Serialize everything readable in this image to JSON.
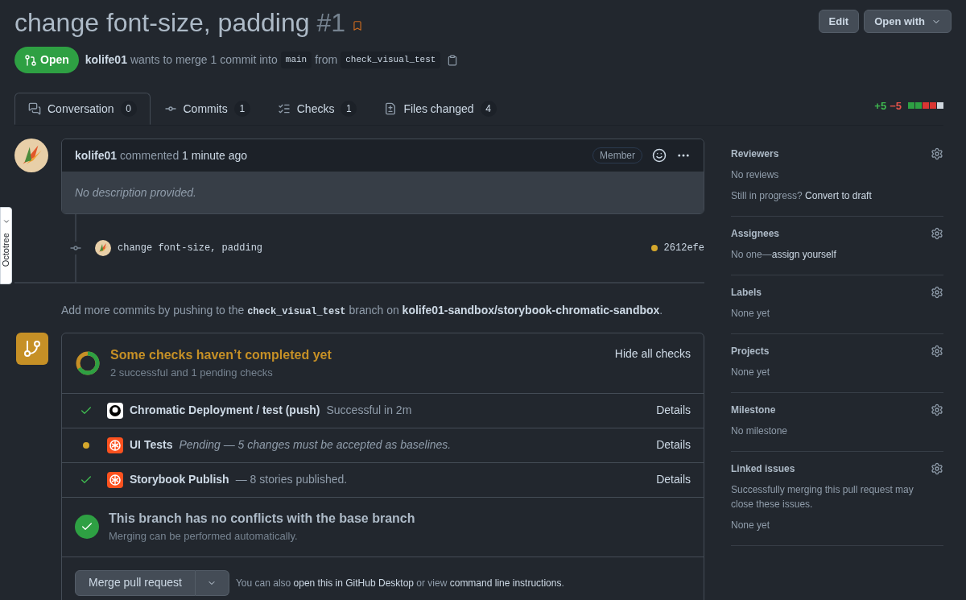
{
  "header": {
    "title": "change font-size, padding",
    "number": "#1",
    "buttons": [
      {
        "label": "Edit",
        "dropdown": false
      },
      {
        "label": "Open with",
        "dropdown": true
      }
    ]
  },
  "state": {
    "label": "Open",
    "author": "kolife01",
    "text": "wants to merge 1 commit into",
    "base": "main",
    "from": "from",
    "head": "check_visual_test"
  },
  "tabs": [
    {
      "label": "Conversation",
      "count": "0",
      "kind": "conversation",
      "selected": true
    },
    {
      "label": "Commits",
      "count": "1",
      "kind": "commit",
      "selected": false
    },
    {
      "label": "Checks",
      "count": "1",
      "kind": "checks",
      "selected": false
    },
    {
      "label": "Files changed",
      "count": "4",
      "kind": "files",
      "selected": false
    }
  ],
  "diffstat": {
    "additions": "+5",
    "deletions": "−5",
    "blocks": [
      {
        "color": "#2ea043"
      },
      {
        "color": "#2ea043"
      },
      {
        "color": "#da3633"
      },
      {
        "color": "#da3633"
      },
      {
        "color": "#d0d7de"
      }
    ]
  },
  "comment": {
    "author": "kolife01",
    "action": "commented",
    "time": "1 minute ago",
    "badge": "Member",
    "body": "No description provided."
  },
  "commit": {
    "message": "change font-size, padding",
    "sha": "2612efe",
    "kind": "pending"
  },
  "push_note": {
    "prefix": "Add more commits by pushing to the",
    "branch": "check_visual_test",
    "middle": "branch on",
    "repo": "kolife01-sandbox/storybook-chromatic-sandbox",
    "suffix": "."
  },
  "checks": {
    "title": "Some checks haven’t completed yet",
    "subtitle": "2 successful and 1 pending checks",
    "toggle": "Hide all checks",
    "items": [
      {
        "kind": "success",
        "name": "Chromatic Deployment / test (push)",
        "description": "Successful in 2m",
        "details": "Details"
      },
      {
        "kind": "pending",
        "name": "UI Tests",
        "description": "Pending — 5 changes must be accepted as baselines.",
        "details": "Details"
      },
      {
        "kind": "success",
        "name": "Storybook Publish",
        "description": "— 8 stories published.",
        "details": "Details"
      }
    ]
  },
  "merge_status": {
    "title": "This branch has no conflicts with the base branch",
    "subtitle": "Merging can be performed automatically."
  },
  "merge": {
    "button": "Merge pull request",
    "prefix": "You can also",
    "link1": "open this in GitHub Desktop",
    "middle": "or view",
    "link2": "command line instructions",
    "suffix": "."
  },
  "sidebar": [
    {
      "title": "Reviewers",
      "lines": [
        [
          {
            "text": "No reviews",
            "link": false
          }
        ],
        [
          {
            "text": "Still in progress?",
            "link": false
          },
          {
            "text": "Convert to draft",
            "link": true
          }
        ]
      ]
    },
    {
      "title": "Assignees",
      "lines": [
        [
          {
            "text": "No one—",
            "link": false
          },
          {
            "text": "assign yourself",
            "link": true
          }
        ]
      ]
    },
    {
      "title": "Labels",
      "lines": [
        [
          {
            "text": "None yet",
            "link": false
          }
        ]
      ]
    },
    {
      "title": "Projects",
      "lines": [
        [
          {
            "text": "None yet",
            "link": false
          }
        ]
      ]
    },
    {
      "title": "Milestone",
      "lines": [
        [
          {
            "text": "No milestone",
            "link": false
          }
        ]
      ]
    },
    {
      "title": "Linked issues",
      "lines": [
        [
          {
            "text": "Successfully merging this pull request may close these issues.",
            "link": false
          }
        ],
        [
          {
            "text": "None yet",
            "link": false
          }
        ]
      ]
    }
  ],
  "octotree": {
    "label": "Octotree"
  }
}
